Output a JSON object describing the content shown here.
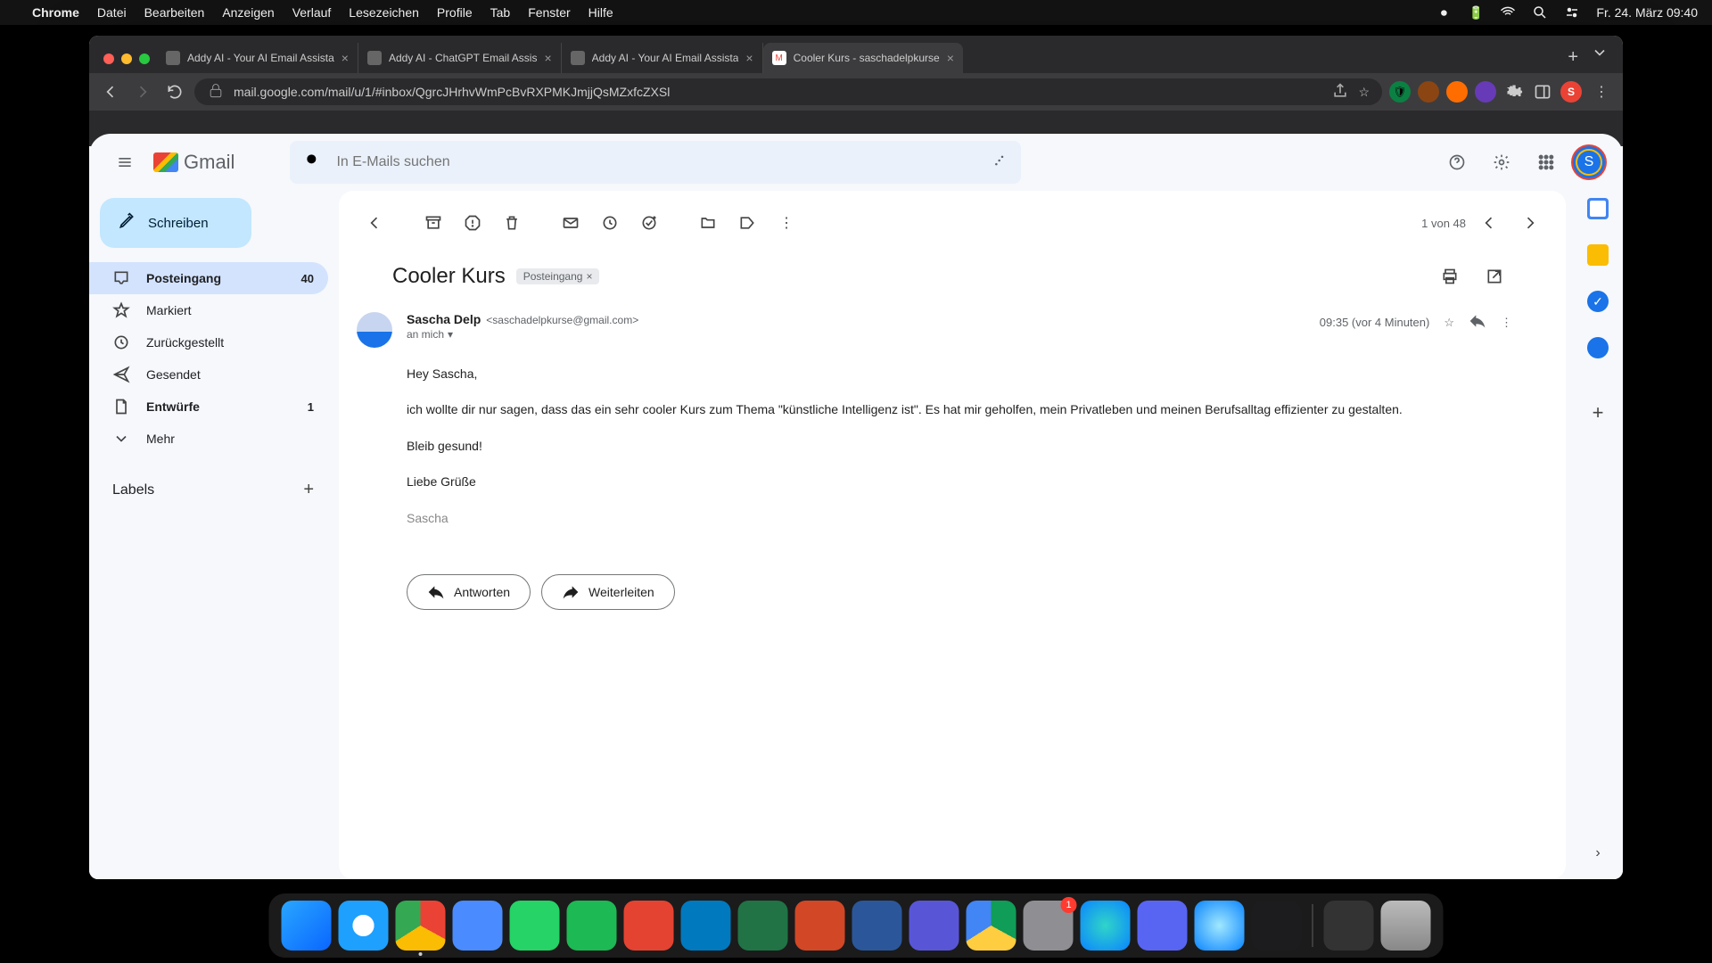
{
  "menubar": {
    "app": "Chrome",
    "items": [
      "Datei",
      "Bearbeiten",
      "Anzeigen",
      "Verlauf",
      "Lesezeichen",
      "Profile",
      "Tab",
      "Fenster",
      "Hilfe"
    ],
    "datetime": "Fr. 24. März  09:40"
  },
  "browser": {
    "tabs": [
      {
        "title": "Addy AI - Your AI Email Assista"
      },
      {
        "title": "Addy AI - ChatGPT Email Assis"
      },
      {
        "title": "Addy AI - Your AI Email Assista"
      },
      {
        "title": "Cooler Kurs - saschadelpkurse",
        "active": true
      }
    ],
    "url": "mail.google.com/mail/u/1/#inbox/QgrcJHrhvWmPcBvRXPMKJmjjQsMZxfcZXSl"
  },
  "gmail": {
    "logo_text": "Gmail",
    "search_placeholder": "In E-Mails suchen",
    "avatar_letter": "S",
    "compose": "Schreiben",
    "sidebar": [
      {
        "icon": "inbox",
        "label": "Posteingang",
        "count": "40",
        "active": true
      },
      {
        "icon": "star",
        "label": "Markiert"
      },
      {
        "icon": "clock",
        "label": "Zurückgestellt"
      },
      {
        "icon": "send",
        "label": "Gesendet"
      },
      {
        "icon": "draft",
        "label": "Entwürfe",
        "count": "1",
        "bold": true
      },
      {
        "icon": "more",
        "label": "Mehr"
      }
    ],
    "labels_header": "Labels",
    "pager": "1 von 48",
    "subject": "Cooler Kurs",
    "chip": "Posteingang",
    "sender_name": "Sascha Delp",
    "sender_email": "<saschadelpkurse@gmail.com>",
    "recipient": "an mich",
    "timestamp": "09:35 (vor 4 Minuten)",
    "body": {
      "greeting": "Hey Sascha,",
      "para1": "ich wollte dir nur sagen, dass das ein sehr cooler Kurs zum Thema \"künstliche Intelligenz ist\". Es hat mir geholfen, mein Privatleben und meinen Berufsalltag effizienter zu gestalten.",
      "para2": "Bleib gesund!",
      "closing": "Liebe Grüße",
      "signature": "Sascha"
    },
    "reply": "Antworten",
    "forward": "Weiterleiten"
  },
  "dock": [
    {
      "name": "finder",
      "bg": "linear-gradient(135deg,#29a7ff,#0a66ff)"
    },
    {
      "name": "safari",
      "bg": "radial-gradient(circle,#fff 30%,#1ea0ff 31%)"
    },
    {
      "name": "chrome",
      "bg": "conic-gradient(#ea4335 0 33%,#fbbc04 33% 66%,#34a853 66% 100%)",
      "dot": true
    },
    {
      "name": "zoom",
      "bg": "#4a8cff"
    },
    {
      "name": "whatsapp",
      "bg": "#25d366"
    },
    {
      "name": "spotify",
      "bg": "#1db954"
    },
    {
      "name": "todoist",
      "bg": "#e44332"
    },
    {
      "name": "trello",
      "bg": "#0079bf"
    },
    {
      "name": "excel",
      "bg": "#217346"
    },
    {
      "name": "powerpoint",
      "bg": "#d24726"
    },
    {
      "name": "word",
      "bg": "#2b579a"
    },
    {
      "name": "imovie",
      "bg": "#5856d6"
    },
    {
      "name": "drive",
      "bg": "conic-gradient(#0f9d58 0 33%,#ffcd40 33% 66%,#4285f4 66%)"
    },
    {
      "name": "settings",
      "bg": "#8e8e93",
      "badge": "1"
    },
    {
      "name": "siri",
      "bg": "radial-gradient(circle,#30d5c8,#0a84ff)"
    },
    {
      "name": "discord",
      "bg": "#5865f2"
    },
    {
      "name": "quicktime",
      "bg": "radial-gradient(circle,#a0e8ff,#0a84ff)"
    },
    {
      "name": "voice",
      "bg": "#1c1c1e"
    }
  ]
}
